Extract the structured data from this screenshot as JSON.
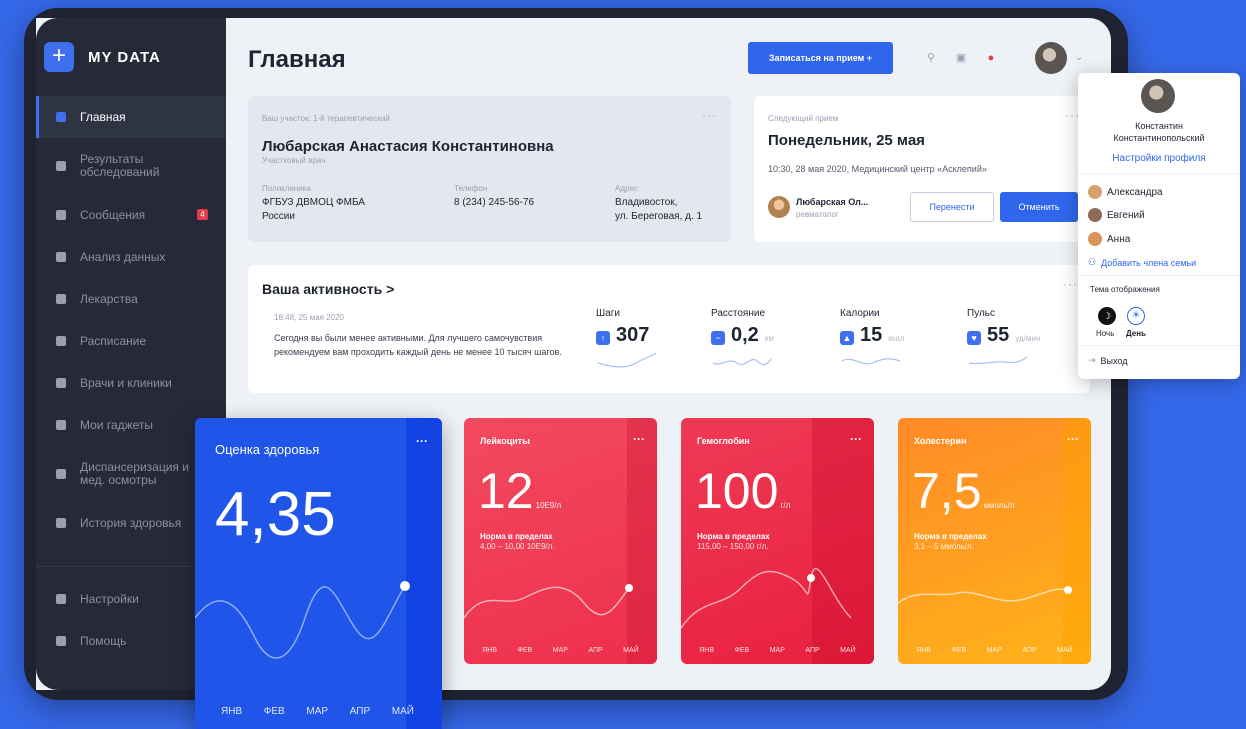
{
  "app": {
    "logo_symbol": "+",
    "name": "MY DATA"
  },
  "sidebar": {
    "items": [
      {
        "label": "Главная",
        "icon": "home-icon"
      },
      {
        "label": "Результаты обследований",
        "icon": "heart-icon"
      },
      {
        "label": "Сообщения",
        "icon": "mail-icon",
        "badge": "4"
      },
      {
        "label": "Анализ данных",
        "icon": "chart-icon"
      },
      {
        "label": "Лекарства",
        "icon": "pill-icon"
      },
      {
        "label": "Расписание",
        "icon": "calendar-icon"
      },
      {
        "label": "Врачи и клиники",
        "icon": "doctor-icon"
      },
      {
        "label": "Мои гаджеты",
        "icon": "device-icon"
      },
      {
        "label": "Диспансеризация и мед. осмотры",
        "icon": "shield-icon"
      },
      {
        "label": "История здоровья",
        "icon": "book-icon"
      }
    ],
    "bottom": [
      {
        "label": "Настройки",
        "icon": "gear-icon"
      },
      {
        "label": "Помощь",
        "icon": "help-icon"
      }
    ]
  },
  "header": {
    "title": "Главная",
    "cta_label": "Записаться на прием +"
  },
  "doctor_card": {
    "subtitle": "Ваш участок: 1-й терапевтический",
    "name": "Любарская Анастасия Константиновна",
    "role": "Участковый врач",
    "clinic_label": "Поликлиника",
    "clinic_line1": "ФГБУЗ ДВМОЦ ФМБА",
    "clinic_line2": "России",
    "phone_label": "Телефон",
    "phone": "8 (234) 245-56-76",
    "address_label": "Адрес",
    "address_line1": "Владивосток,",
    "address_line2": "ул. Береговая, д. 1"
  },
  "next_appointment": {
    "label": "Следующий прием",
    "date": "Понедельник, 25 мая",
    "details": "10:30, 28 мая 2020, Медицинский центр «Асклепий»",
    "doctor_name": "Любарская Ол...",
    "doctor_specialty": "ревматолог",
    "reschedule_label": "Перенести",
    "cancel_label": "Отменить"
  },
  "activity": {
    "title": "Ваша активность >",
    "timestamp": "18:48, 25 мая 2020",
    "message": "Сегодня вы были менее активными. Для лучшего самочувствия рекомендуем вам проходить каждый день не менее 10 тысяч шагов.",
    "metrics": [
      {
        "label": "Шаги",
        "value": "307",
        "unit": "",
        "icon": "steps-icon"
      },
      {
        "label": "Расстояние",
        "value": "0,2",
        "unit": "км",
        "icon": "distance-icon"
      },
      {
        "label": "Калории",
        "value": "15",
        "unit": "ккал",
        "icon": "flame-icon"
      },
      {
        "label": "Пульс",
        "value": "55",
        "unit": "уд/мин",
        "icon": "heart-icon"
      }
    ]
  },
  "cards": [
    {
      "title": "Оценка здоровья",
      "value": "4,35",
      "unit": "",
      "norm_title": "",
      "norm_range": "",
      "color": "#1f55e8"
    },
    {
      "title": "Лейкоциты",
      "value": "12",
      "unit": "10Е9/л",
      "norm_title": "Норма в пределах",
      "norm_range": "4,00 – 10,00 10Е9/л.",
      "color": "#f0364f"
    },
    {
      "title": "Гемоглобин",
      "value": "100",
      "unit": "г/л",
      "norm_title": "Норма в пределах",
      "norm_range": "115,00 – 150,00 г/л.",
      "color": "#ee2a4a"
    },
    {
      "title": "Холестерин",
      "value": "7,5",
      "unit": "ммоль/л",
      "norm_title": "Норма в пределах",
      "norm_range": "3,1 – 5 ммоль/л.",
      "color": "#ff9a1f"
    }
  ],
  "months": [
    "ЯНВ",
    "ФЕВ",
    "МАР",
    "АПР",
    "МАЙ"
  ],
  "profile_menu": {
    "name_line1": "Константин",
    "name_line2": "Константинопольский",
    "settings_label": "Настройки профиля",
    "family": [
      "Александра",
      "Евгений",
      "Анна"
    ],
    "add_family_label": "Добавить члена семьи",
    "theme_label": "Тема отображения",
    "theme_night": "Ночь",
    "theme_day": "День",
    "logout_label": "Выход"
  }
}
